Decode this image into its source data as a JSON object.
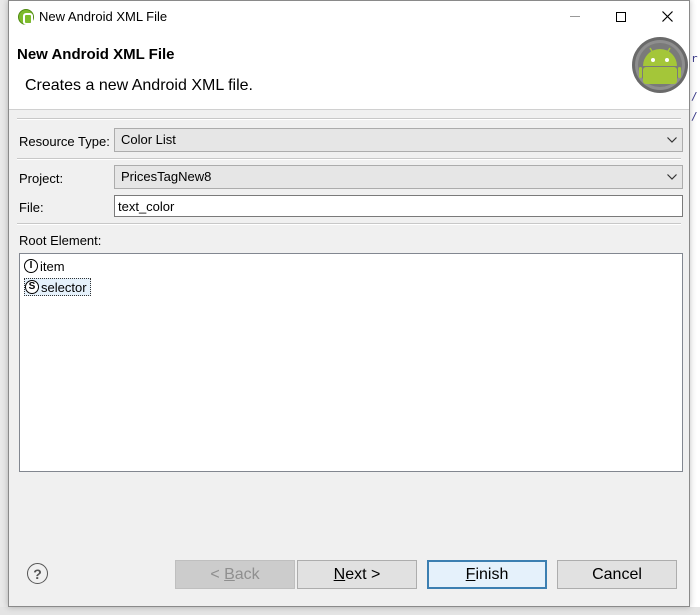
{
  "window": {
    "title": "New Android XML File"
  },
  "header": {
    "title": "New Android XML File",
    "description": "Creates a new Android XML file."
  },
  "form": {
    "resource_type_label": "Resource Type:",
    "resource_type_value": "Color List",
    "project_label": "Project:",
    "project_value": "PricesTagNew8",
    "file_label": "File:",
    "file_value": "text_color",
    "root_element_label": "Root Element:"
  },
  "root_elements": [
    {
      "badge": "I",
      "label": "item",
      "selected": false
    },
    {
      "badge": "S",
      "label": "selector",
      "selected": true
    }
  ],
  "buttons": {
    "help": "?",
    "back_prefix": "< ",
    "back_mnemonic": "B",
    "back_rest": "ack",
    "next_mnemonic": "N",
    "next_rest": "ext >",
    "finish_mnemonic": "F",
    "finish_rest": "inish",
    "cancel": "Cancel"
  },
  "icons": {
    "app": "android-icon",
    "minimize": "minimize-icon",
    "maximize": "maximize-icon",
    "close": "close-icon",
    "dropdown": "chevron-down-icon",
    "help": "help-icon"
  },
  "colors": {
    "android_green": "#a4c639",
    "default_button_border": "#3c7fb1",
    "selection_bg": "#e5f1fb"
  }
}
